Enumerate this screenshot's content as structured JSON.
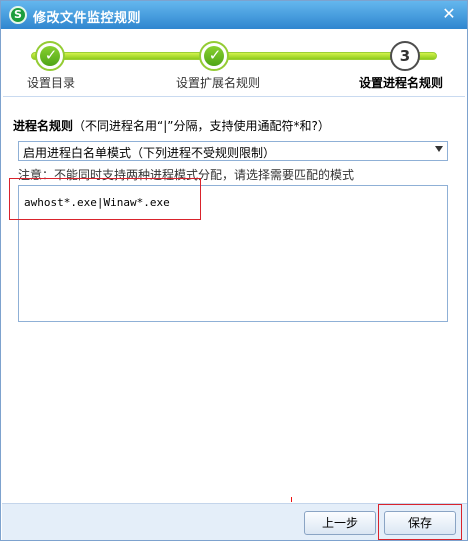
{
  "window": {
    "title": "修改文件监控规则",
    "app_icon_letter": "S",
    "close_glyph": "✕"
  },
  "stepper": {
    "steps": [
      {
        "label": "设置目录",
        "state": "done"
      },
      {
        "label": "设置扩展名规则",
        "state": "done"
      },
      {
        "label": "设置进程名规则",
        "state": "current",
        "number": "3"
      }
    ],
    "check_glyph": "✓"
  },
  "form": {
    "rule_title": "进程名规则",
    "rule_hint": "（不同进程名用“|”分隔，支持使用通配符*和?）",
    "mode_select": {
      "selected": "启用进程白名单模式（下列进程不受规则限制）"
    },
    "note": "注意：不能同时支持两种进程模式分配，请选择需要匹配的模式",
    "process_text": "awhost*.exe|Winaw*.exe"
  },
  "footer": {
    "prev_label": "上一步",
    "save_label": "保存"
  },
  "colors": {
    "titlebar": "#2f86cf",
    "progress": "#8ecb1d",
    "highlight": "#d9232c"
  }
}
